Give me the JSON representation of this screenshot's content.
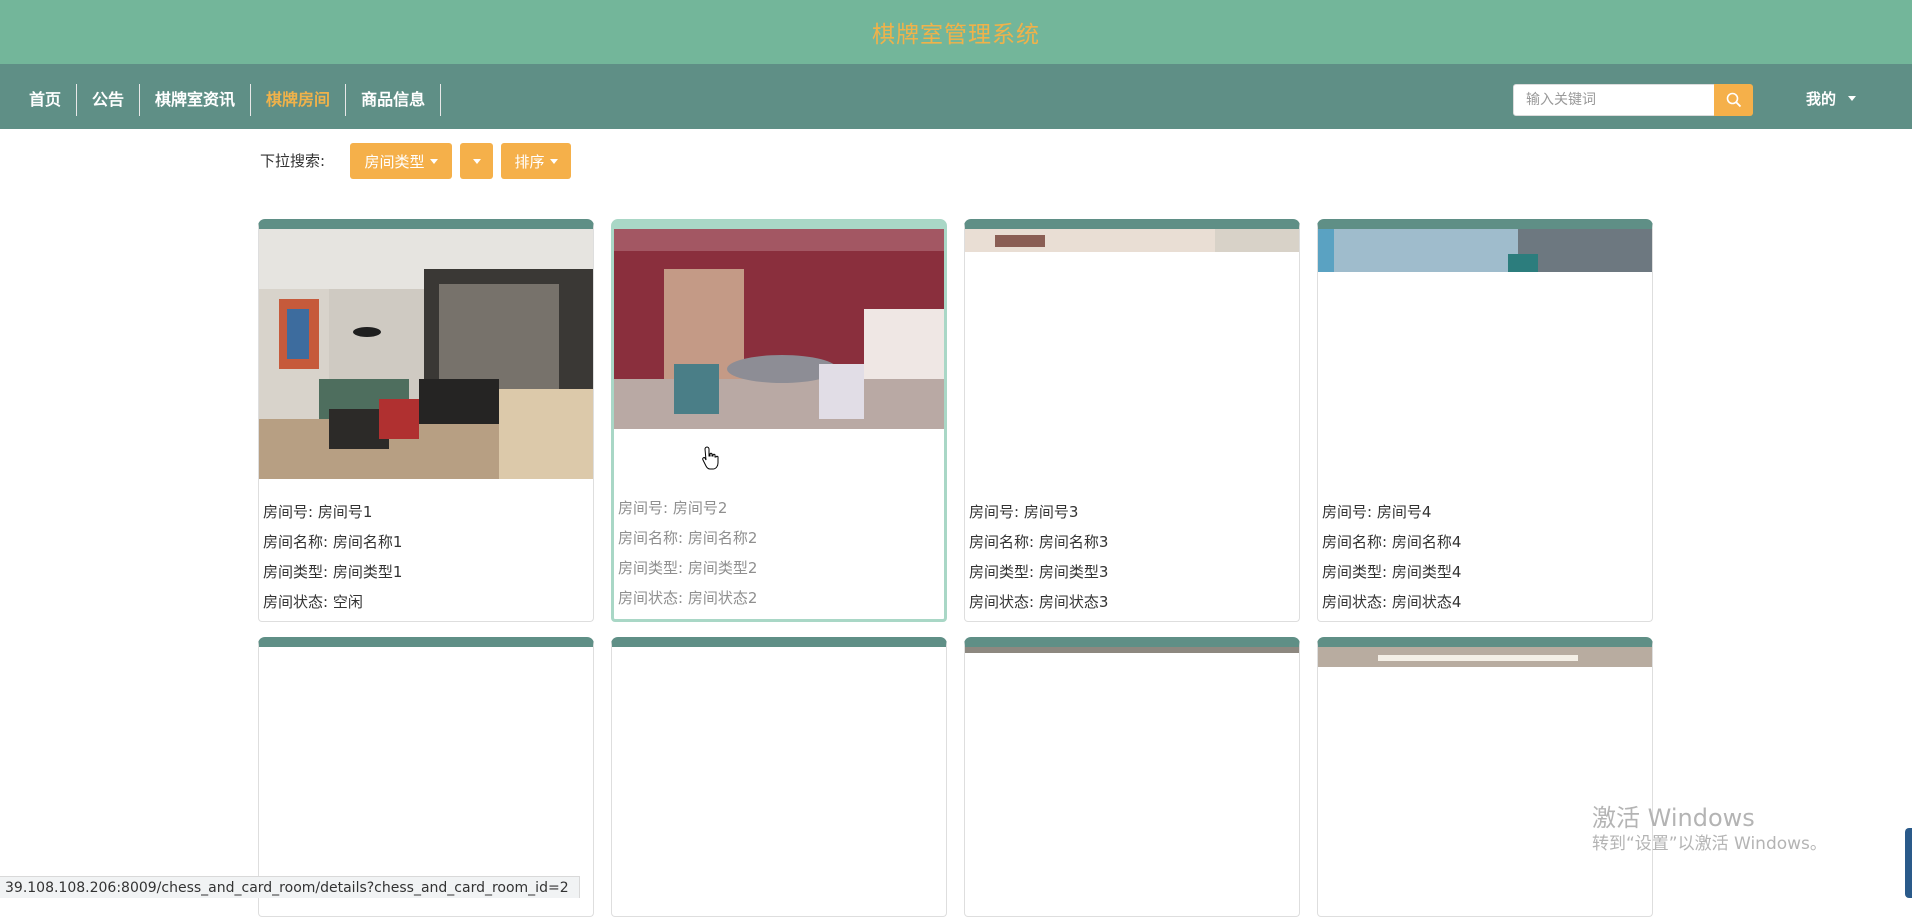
{
  "header": {
    "title": "棋牌室管理系统"
  },
  "nav": {
    "items": [
      {
        "label": "首页",
        "active": false
      },
      {
        "label": "公告",
        "active": false
      },
      {
        "label": "棋牌室资讯",
        "active": false
      },
      {
        "label": "棋牌房间",
        "active": true
      },
      {
        "label": "商品信息",
        "active": false
      }
    ],
    "search_placeholder": "输入关键词",
    "user_menu": "我的"
  },
  "filters": {
    "label": "下拉搜索:",
    "room_type_button": "房间类型",
    "blank_button": "",
    "sort_button": "排序"
  },
  "rooms": [
    {
      "no_label": "房间号:",
      "no": "房间号1",
      "name_label": "房间名称:",
      "name": "房间名称1",
      "type_label": "房间类型:",
      "type": "房间类型1",
      "status_label": "房间状态:",
      "status": "空闲"
    },
    {
      "no_label": "房间号:",
      "no": "房间号2",
      "name_label": "房间名称:",
      "name": "房间名称2",
      "type_label": "房间类型:",
      "type": "房间类型2",
      "status_label": "房间状态:",
      "status": "房间状态2"
    },
    {
      "no_label": "房间号:",
      "no": "房间号3",
      "name_label": "房间名称:",
      "name": "房间名称3",
      "type_label": "房间类型:",
      "type": "房间类型3",
      "status_label": "房间状态:",
      "status": "房间状态3"
    },
    {
      "no_label": "房间号:",
      "no": "房间号4",
      "name_label": "房间名称:",
      "name": "房间名称4",
      "type_label": "房间类型:",
      "type": "房间类型4",
      "status_label": "房间状态:",
      "status": "房间状态4"
    }
  ],
  "status_bar": {
    "url": "39.108.108.206:8009/chess_and_card_room/details?chess_and_card_room_id=2"
  },
  "watermark": {
    "line1": "激活 Windows",
    "line2": "转到“设置”以激活 Windows。"
  },
  "colors": {
    "title_bar": "#73b69a",
    "nav_bar": "#5f8f86",
    "accent": "#f0b24a",
    "button": "#f5b04a"
  }
}
